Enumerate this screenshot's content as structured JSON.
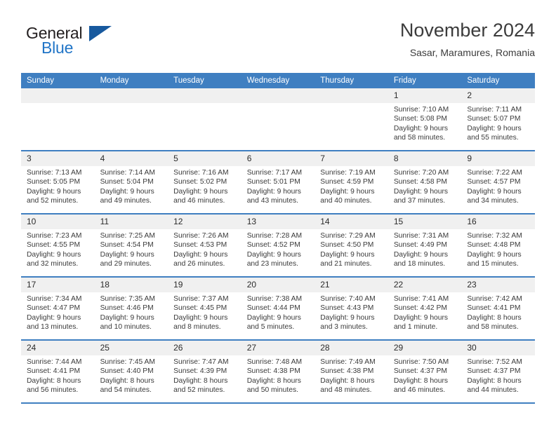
{
  "brand": {
    "name_top": "General",
    "name_bottom": "Blue",
    "accent_color": "#2175c7",
    "triangle_color": "#17599e"
  },
  "header": {
    "title": "November 2024",
    "subtitle": "Sasar, Maramures, Romania"
  },
  "theme": {
    "header_row_bg": "#3f7fc1",
    "daynum_bg": "#f0f0f0",
    "text_color": "#3a3a3a"
  },
  "calendar": {
    "weekday_headers": [
      "Sunday",
      "Monday",
      "Tuesday",
      "Wednesday",
      "Thursday",
      "Friday",
      "Saturday"
    ],
    "labels": {
      "sunrise": "Sunrise:",
      "sunset": "Sunset:",
      "daylight": "Daylight:"
    },
    "weeks": [
      [
        {
          "day": "",
          "empty": true
        },
        {
          "day": "",
          "empty": true
        },
        {
          "day": "",
          "empty": true
        },
        {
          "day": "",
          "empty": true
        },
        {
          "day": "",
          "empty": true
        },
        {
          "day": "1",
          "sunrise": "Sunrise: 7:10 AM",
          "sunset": "Sunset: 5:08 PM",
          "daylight_1": "Daylight: 9 hours",
          "daylight_2": "and 58 minutes."
        },
        {
          "day": "2",
          "sunrise": "Sunrise: 7:11 AM",
          "sunset": "Sunset: 5:07 PM",
          "daylight_1": "Daylight: 9 hours",
          "daylight_2": "and 55 minutes."
        }
      ],
      [
        {
          "day": "3",
          "sunrise": "Sunrise: 7:13 AM",
          "sunset": "Sunset: 5:05 PM",
          "daylight_1": "Daylight: 9 hours",
          "daylight_2": "and 52 minutes."
        },
        {
          "day": "4",
          "sunrise": "Sunrise: 7:14 AM",
          "sunset": "Sunset: 5:04 PM",
          "daylight_1": "Daylight: 9 hours",
          "daylight_2": "and 49 minutes."
        },
        {
          "day": "5",
          "sunrise": "Sunrise: 7:16 AM",
          "sunset": "Sunset: 5:02 PM",
          "daylight_1": "Daylight: 9 hours",
          "daylight_2": "and 46 minutes."
        },
        {
          "day": "6",
          "sunrise": "Sunrise: 7:17 AM",
          "sunset": "Sunset: 5:01 PM",
          "daylight_1": "Daylight: 9 hours",
          "daylight_2": "and 43 minutes."
        },
        {
          "day": "7",
          "sunrise": "Sunrise: 7:19 AM",
          "sunset": "Sunset: 4:59 PM",
          "daylight_1": "Daylight: 9 hours",
          "daylight_2": "and 40 minutes."
        },
        {
          "day": "8",
          "sunrise": "Sunrise: 7:20 AM",
          "sunset": "Sunset: 4:58 PM",
          "daylight_1": "Daylight: 9 hours",
          "daylight_2": "and 37 minutes."
        },
        {
          "day": "9",
          "sunrise": "Sunrise: 7:22 AM",
          "sunset": "Sunset: 4:57 PM",
          "daylight_1": "Daylight: 9 hours",
          "daylight_2": "and 34 minutes."
        }
      ],
      [
        {
          "day": "10",
          "sunrise": "Sunrise: 7:23 AM",
          "sunset": "Sunset: 4:55 PM",
          "daylight_1": "Daylight: 9 hours",
          "daylight_2": "and 32 minutes."
        },
        {
          "day": "11",
          "sunrise": "Sunrise: 7:25 AM",
          "sunset": "Sunset: 4:54 PM",
          "daylight_1": "Daylight: 9 hours",
          "daylight_2": "and 29 minutes."
        },
        {
          "day": "12",
          "sunrise": "Sunrise: 7:26 AM",
          "sunset": "Sunset: 4:53 PM",
          "daylight_1": "Daylight: 9 hours",
          "daylight_2": "and 26 minutes."
        },
        {
          "day": "13",
          "sunrise": "Sunrise: 7:28 AM",
          "sunset": "Sunset: 4:52 PM",
          "daylight_1": "Daylight: 9 hours",
          "daylight_2": "and 23 minutes."
        },
        {
          "day": "14",
          "sunrise": "Sunrise: 7:29 AM",
          "sunset": "Sunset: 4:50 PM",
          "daylight_1": "Daylight: 9 hours",
          "daylight_2": "and 21 minutes."
        },
        {
          "day": "15",
          "sunrise": "Sunrise: 7:31 AM",
          "sunset": "Sunset: 4:49 PM",
          "daylight_1": "Daylight: 9 hours",
          "daylight_2": "and 18 minutes."
        },
        {
          "day": "16",
          "sunrise": "Sunrise: 7:32 AM",
          "sunset": "Sunset: 4:48 PM",
          "daylight_1": "Daylight: 9 hours",
          "daylight_2": "and 15 minutes."
        }
      ],
      [
        {
          "day": "17",
          "sunrise": "Sunrise: 7:34 AM",
          "sunset": "Sunset: 4:47 PM",
          "daylight_1": "Daylight: 9 hours",
          "daylight_2": "and 13 minutes."
        },
        {
          "day": "18",
          "sunrise": "Sunrise: 7:35 AM",
          "sunset": "Sunset: 4:46 PM",
          "daylight_1": "Daylight: 9 hours",
          "daylight_2": "and 10 minutes."
        },
        {
          "day": "19",
          "sunrise": "Sunrise: 7:37 AM",
          "sunset": "Sunset: 4:45 PM",
          "daylight_1": "Daylight: 9 hours",
          "daylight_2": "and 8 minutes."
        },
        {
          "day": "20",
          "sunrise": "Sunrise: 7:38 AM",
          "sunset": "Sunset: 4:44 PM",
          "daylight_1": "Daylight: 9 hours",
          "daylight_2": "and 5 minutes."
        },
        {
          "day": "21",
          "sunrise": "Sunrise: 7:40 AM",
          "sunset": "Sunset: 4:43 PM",
          "daylight_1": "Daylight: 9 hours",
          "daylight_2": "and 3 minutes."
        },
        {
          "day": "22",
          "sunrise": "Sunrise: 7:41 AM",
          "sunset": "Sunset: 4:42 PM",
          "daylight_1": "Daylight: 9 hours",
          "daylight_2": "and 1 minute."
        },
        {
          "day": "23",
          "sunrise": "Sunrise: 7:42 AM",
          "sunset": "Sunset: 4:41 PM",
          "daylight_1": "Daylight: 8 hours",
          "daylight_2": "and 58 minutes."
        }
      ],
      [
        {
          "day": "24",
          "sunrise": "Sunrise: 7:44 AM",
          "sunset": "Sunset: 4:41 PM",
          "daylight_1": "Daylight: 8 hours",
          "daylight_2": "and 56 minutes."
        },
        {
          "day": "25",
          "sunrise": "Sunrise: 7:45 AM",
          "sunset": "Sunset: 4:40 PM",
          "daylight_1": "Daylight: 8 hours",
          "daylight_2": "and 54 minutes."
        },
        {
          "day": "26",
          "sunrise": "Sunrise: 7:47 AM",
          "sunset": "Sunset: 4:39 PM",
          "daylight_1": "Daylight: 8 hours",
          "daylight_2": "and 52 minutes."
        },
        {
          "day": "27",
          "sunrise": "Sunrise: 7:48 AM",
          "sunset": "Sunset: 4:38 PM",
          "daylight_1": "Daylight: 8 hours",
          "daylight_2": "and 50 minutes."
        },
        {
          "day": "28",
          "sunrise": "Sunrise: 7:49 AM",
          "sunset": "Sunset: 4:38 PM",
          "daylight_1": "Daylight: 8 hours",
          "daylight_2": "and 48 minutes."
        },
        {
          "day": "29",
          "sunrise": "Sunrise: 7:50 AM",
          "sunset": "Sunset: 4:37 PM",
          "daylight_1": "Daylight: 8 hours",
          "daylight_2": "and 46 minutes."
        },
        {
          "day": "30",
          "sunrise": "Sunrise: 7:52 AM",
          "sunset": "Sunset: 4:37 PM",
          "daylight_1": "Daylight: 8 hours",
          "daylight_2": "and 44 minutes."
        }
      ]
    ]
  }
}
